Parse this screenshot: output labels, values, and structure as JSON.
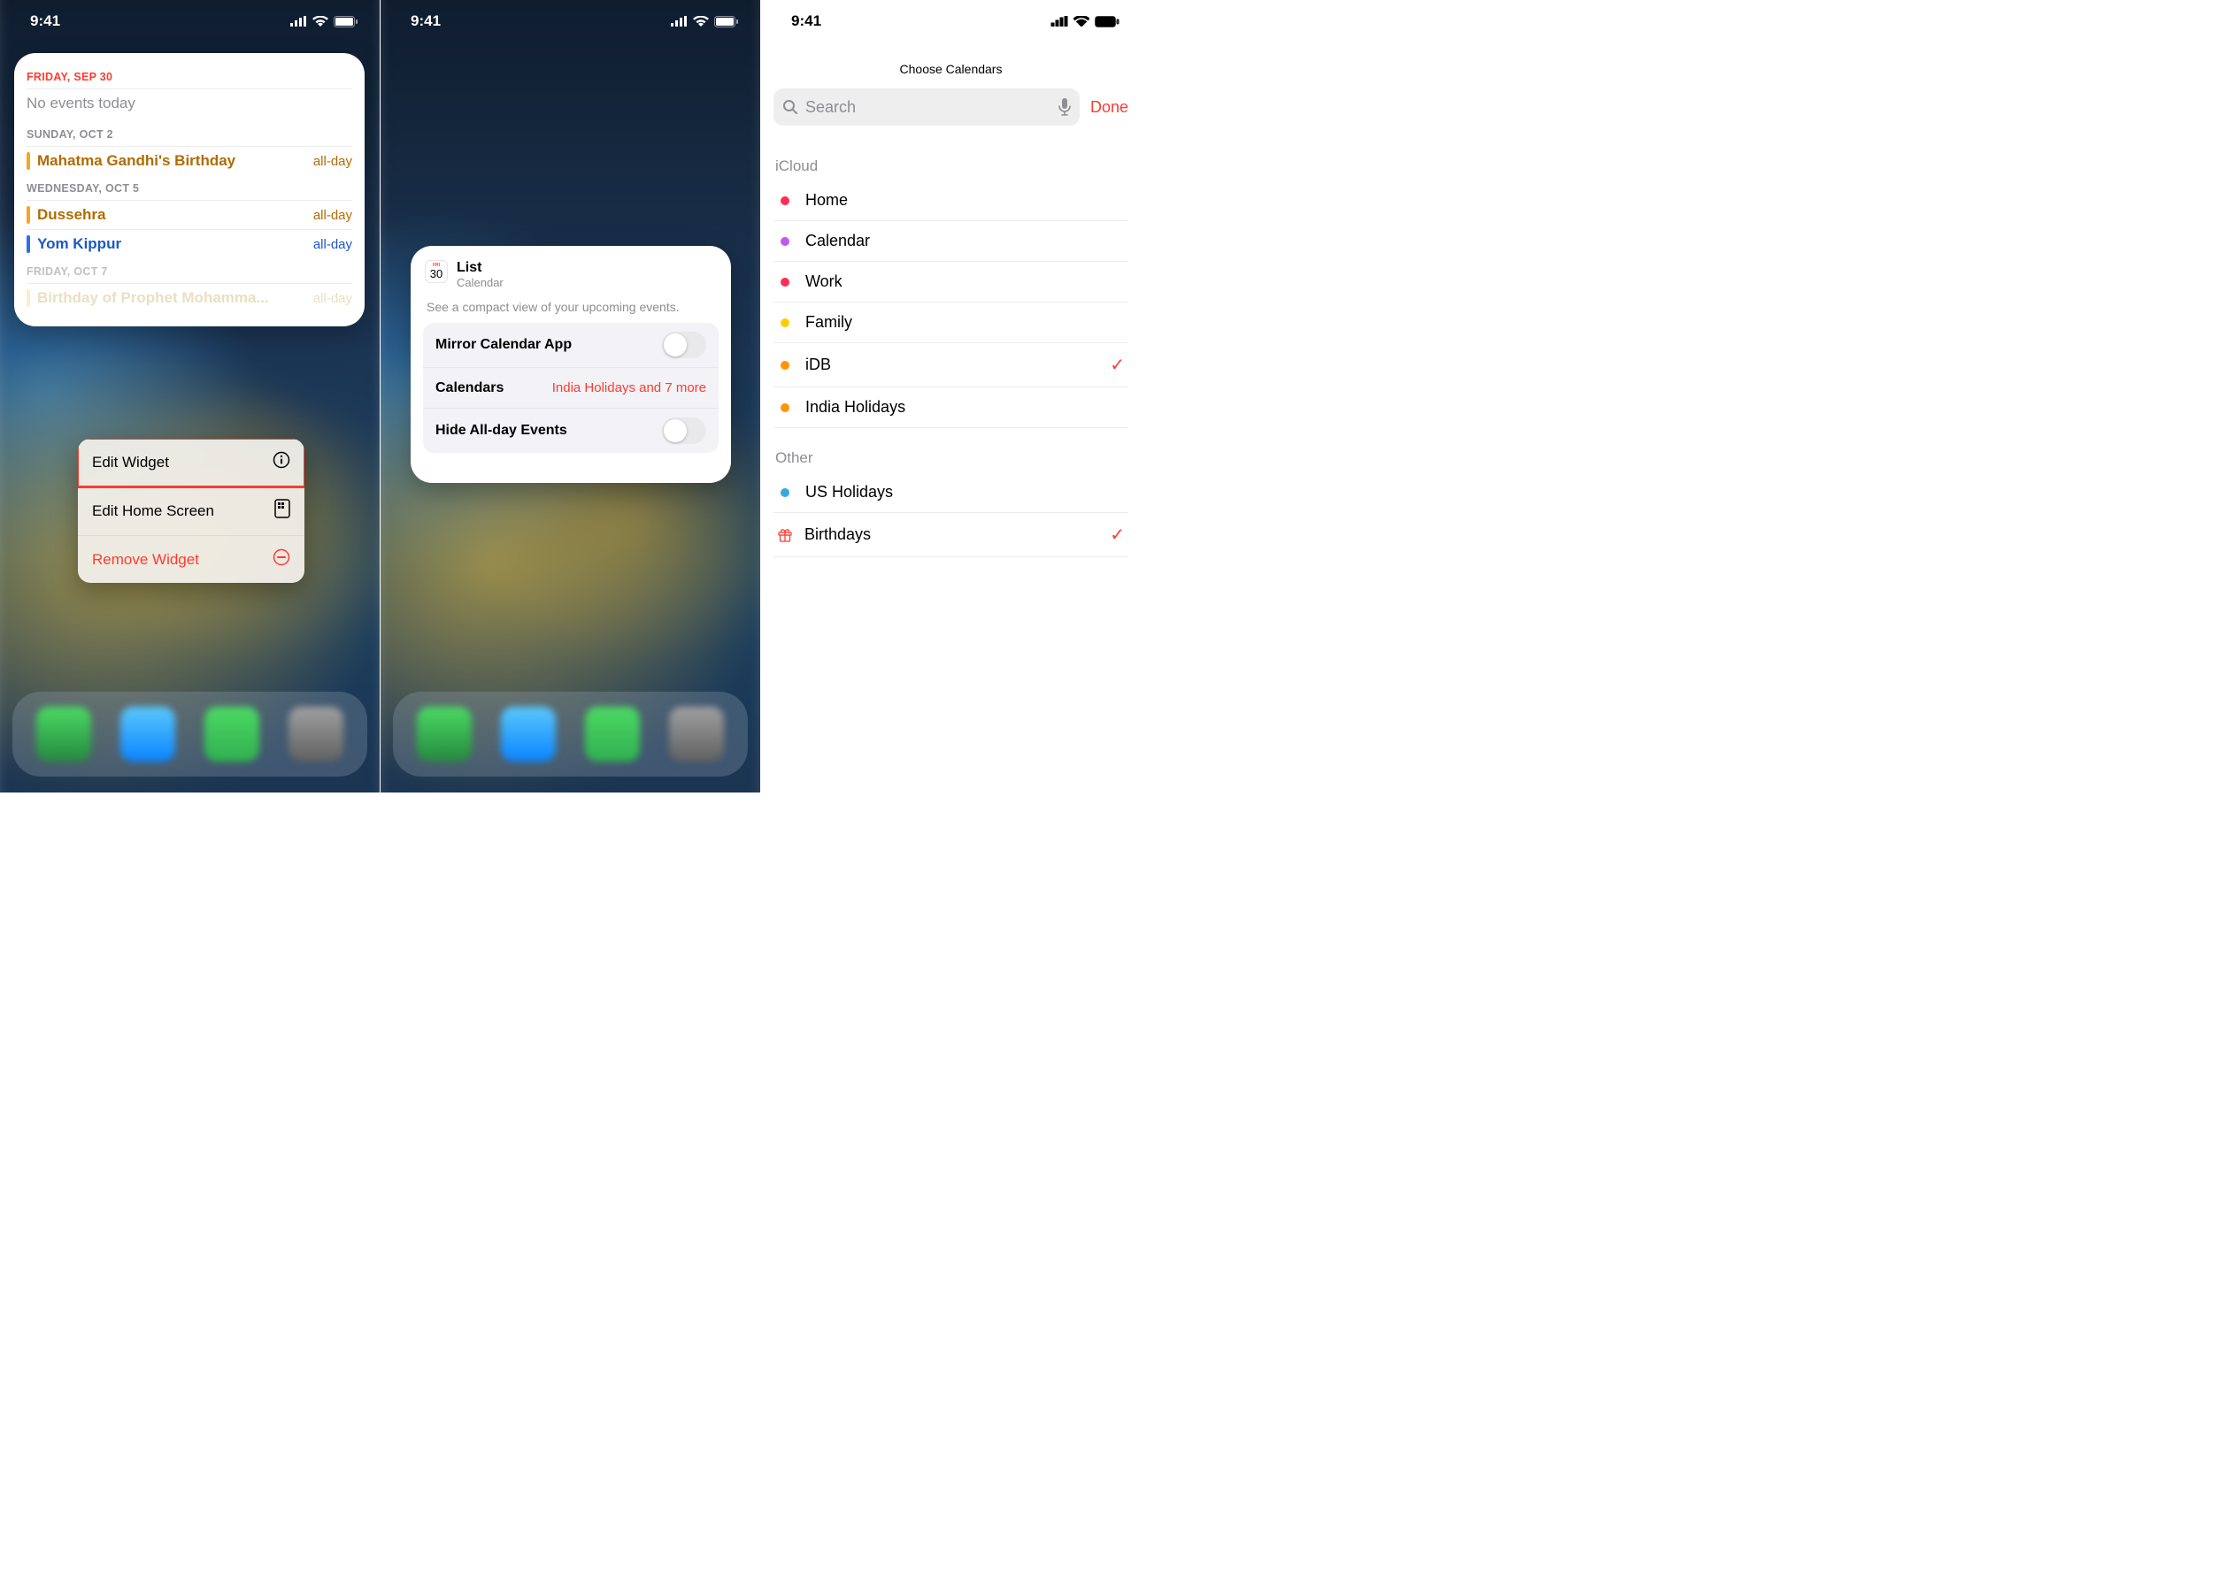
{
  "status_bar": {
    "time": "9:41"
  },
  "screen1": {
    "widget": {
      "days": [
        {
          "header": "FRIDAY, SEP 30",
          "today": true,
          "no_events_label": "No events today",
          "events": []
        },
        {
          "header": "SUNDAY, OCT 2",
          "events": [
            {
              "title": "Mahatma Gandhi's Birthday",
              "time": "all-day",
              "color": "#f5a623",
              "text_color": "#b06c00"
            }
          ]
        },
        {
          "header": "WEDNESDAY, OCT 5",
          "events": [
            {
              "title": "Dussehra",
              "time": "all-day",
              "color": "#f5a623",
              "text_color": "#b06c00"
            },
            {
              "title": "Yom Kippur",
              "time": "all-day",
              "color": "#2f6fea",
              "text_color": "#1a58c9"
            }
          ]
        },
        {
          "header": "FRIDAY, OCT 7",
          "faded": true,
          "events": [
            {
              "title": "Birthday of Prophet Mohamma...",
              "time": "all-day",
              "color": "#f5e1a4",
              "text_color": "#d8c78f",
              "faded": true
            }
          ]
        }
      ]
    },
    "context_menu": [
      {
        "label": "Edit Widget",
        "icon": "info-circle-icon",
        "highlight": true
      },
      {
        "label": "Edit Home Screen",
        "icon": "apps-icon"
      },
      {
        "label": "Remove Widget",
        "icon": "minus-circle-icon",
        "danger": true
      }
    ]
  },
  "screen2": {
    "title": "List",
    "subtitle": "Calendar",
    "icon_day_label": "FRI",
    "icon_day_number": "30",
    "description": "See a compact view of your upcoming events.",
    "options": {
      "mirror_label": "Mirror Calendar App",
      "mirror_on": false,
      "calendars_label": "Calendars",
      "calendars_value": "India Holidays and 7 more",
      "hide_allday_label": "Hide All-day Events",
      "hide_allday_on": false
    }
  },
  "screen3": {
    "title": "Choose Calendars",
    "search_placeholder": "Search",
    "done_label": "Done",
    "sections": [
      {
        "name": "iCloud",
        "items": [
          {
            "name": "Home",
            "color": "#ff2d55",
            "checked": false
          },
          {
            "name": "Calendar",
            "color": "#bf5af2",
            "checked": false
          },
          {
            "name": "Work",
            "color": "#ff2d55",
            "checked": false
          },
          {
            "name": "Family",
            "color": "#ffcc00",
            "checked": false
          },
          {
            "name": "iDB",
            "color": "#ff9500",
            "checked": true
          },
          {
            "name": "India Holidays",
            "color": "#ff9500",
            "checked": false
          }
        ]
      },
      {
        "name": "Other",
        "items": [
          {
            "name": "US Holidays",
            "color": "#34aadc",
            "checked": false
          },
          {
            "name": "Birthdays",
            "color": "#ff3b30",
            "checked": true,
            "gift_icon": true
          }
        ]
      }
    ]
  }
}
